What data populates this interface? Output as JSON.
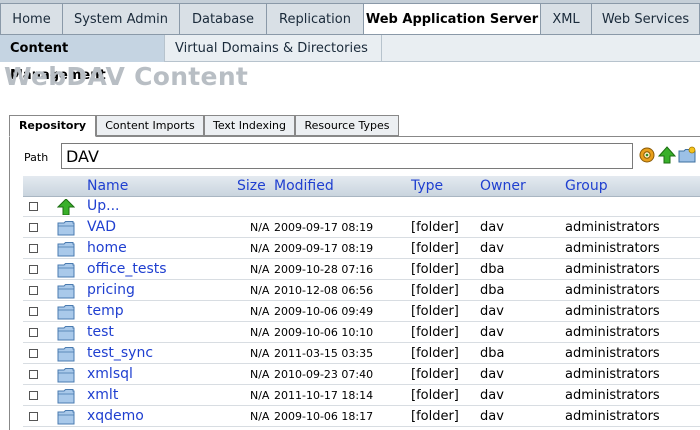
{
  "top_nav": [
    "Home",
    "System Admin",
    "Database",
    "Replication",
    "Web Application Server",
    "XML",
    "Web Services"
  ],
  "sub_nav": [
    "Content Management",
    "Virtual Domains & Directories"
  ],
  "page_title": "WebDAV Content",
  "content_tabs": [
    "Repository",
    "Content Imports",
    "Text Indexing",
    "Resource Types"
  ],
  "path": {
    "label": "Path",
    "value": "DAV"
  },
  "table": {
    "headers": {
      "name": "Name",
      "size": "Size",
      "modified": "Modified",
      "type": "Type",
      "owner": "Owner",
      "group": "Group"
    },
    "up_label": "Up...",
    "rows": [
      {
        "name": "VAD",
        "size": "N/A",
        "modified": "2009-09-17 08:19",
        "type": "[folder]",
        "owner": "dav",
        "group": "administrators"
      },
      {
        "name": "home",
        "size": "N/A",
        "modified": "2009-09-17 08:19",
        "type": "[folder]",
        "owner": "dav",
        "group": "administrators"
      },
      {
        "name": "office_tests",
        "size": "N/A",
        "modified": "2009-10-28 07:16",
        "type": "[folder]",
        "owner": "dba",
        "group": "administrators"
      },
      {
        "name": "pricing",
        "size": "N/A",
        "modified": "2010-12-08 06:56",
        "type": "[folder]",
        "owner": "dba",
        "group": "administrators"
      },
      {
        "name": "temp",
        "size": "N/A",
        "modified": "2009-10-06 09:49",
        "type": "[folder]",
        "owner": "dav",
        "group": "administrators"
      },
      {
        "name": "test",
        "size": "N/A",
        "modified": "2009-10-06 10:10",
        "type": "[folder]",
        "owner": "dav",
        "group": "administrators"
      },
      {
        "name": "test_sync",
        "size": "N/A",
        "modified": "2011-03-15 03:35",
        "type": "[folder]",
        "owner": "dba",
        "group": "administrators"
      },
      {
        "name": "xmlsql",
        "size": "N/A",
        "modified": "2010-09-23 07:40",
        "type": "[folder]",
        "owner": "dav",
        "group": "administrators"
      },
      {
        "name": "xmlt",
        "size": "N/A",
        "modified": "2011-10-17 18:14",
        "type": "[folder]",
        "owner": "dav",
        "group": "administrators"
      },
      {
        "name": "xqdemo",
        "size": "N/A",
        "modified": "2009-10-06 18:17",
        "type": "[folder]",
        "owner": "dav",
        "group": "administrators"
      }
    ]
  }
}
